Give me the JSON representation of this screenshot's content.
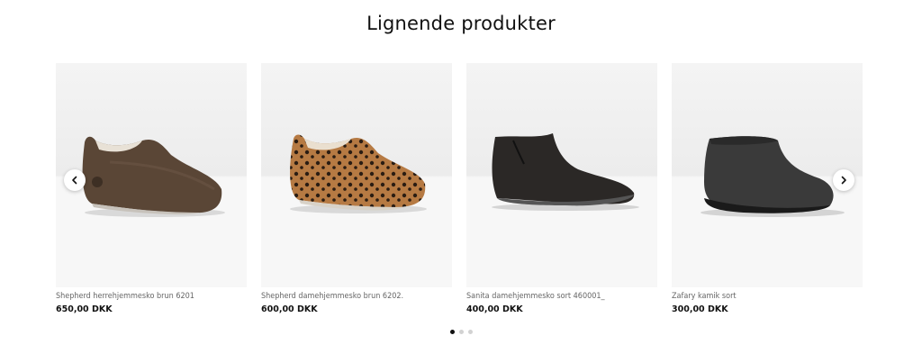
{
  "section": {
    "title": "Lignende produkter"
  },
  "products": [
    {
      "name": "Shepherd herrehjemmesko brun 6201",
      "price": "650,00 DKK"
    },
    {
      "name": "Shepherd damehjemmesko brun 6202.",
      "price": "600,00 DKK"
    },
    {
      "name": "Sanita damehjemmesko sort 460001_",
      "price": "400,00 DKK"
    },
    {
      "name": "Zafary kamik sort",
      "price": "300,00 DKK"
    }
  ],
  "carousel": {
    "prev_icon": "chevron-left-icon",
    "next_icon": "chevron-right-icon",
    "pages": 3,
    "active_page": 1
  }
}
